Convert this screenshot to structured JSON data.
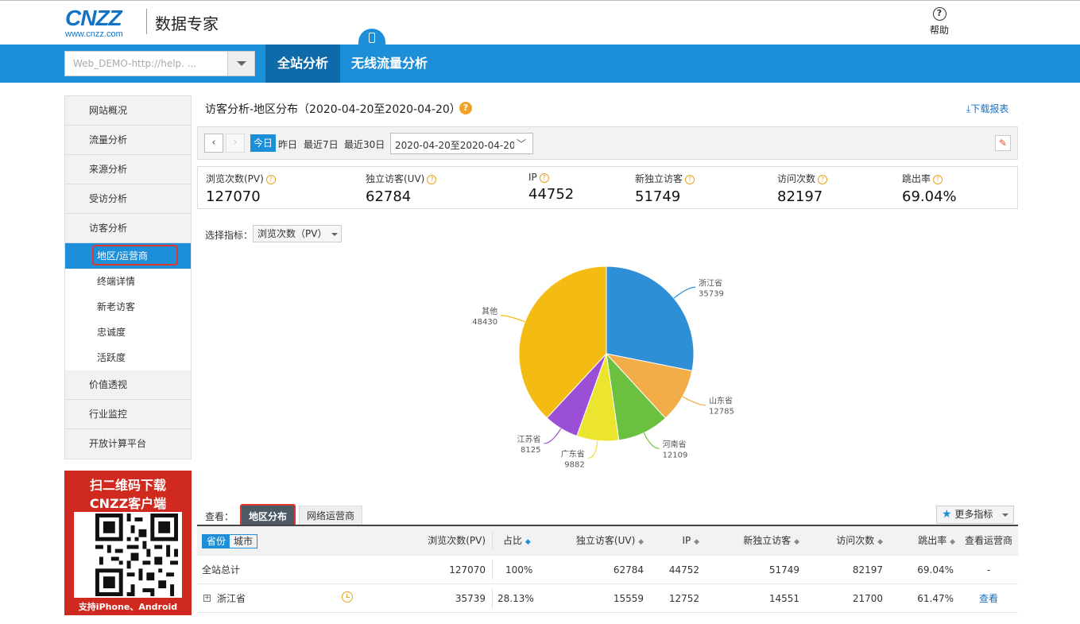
{
  "header": {
    "logo_main": "CNZZ",
    "logo_sub": "www.cnzz.com",
    "brand": "数据专家",
    "help_icon": "question-circle-icon",
    "help_label": "帮助"
  },
  "nav": {
    "site_select_value": "Web_DEMO-http://help. ...",
    "tabs": [
      {
        "label": "全站分析",
        "active": true
      },
      {
        "label": "无线流量分析",
        "active": false
      }
    ],
    "accent": "#1d8fd9"
  },
  "sidebar": {
    "items": [
      {
        "label": "网站概况"
      },
      {
        "label": "流量分析"
      },
      {
        "label": "来源分析"
      },
      {
        "label": "受访分析"
      },
      {
        "label": "访客分析"
      }
    ],
    "subitems": [
      {
        "label": "地区/运营商",
        "active": true
      },
      {
        "label": "终端详情"
      },
      {
        "label": "新老访客"
      },
      {
        "label": "忠诚度"
      },
      {
        "label": "活跃度"
      }
    ],
    "items_after": [
      {
        "label": "价值透视"
      },
      {
        "label": "行业监控"
      },
      {
        "label": "开放计算平台"
      }
    ],
    "promo": {
      "line1": "扫二维码下载",
      "line2": "CNZZ客户端",
      "footer": "支持iPhone、Android"
    }
  },
  "main": {
    "title": "访客分析-地区分布（2020-04-20至2020-04-20）",
    "download_label": "下载报表",
    "date_bar": {
      "today": "今日",
      "yesterday": "昨日",
      "last7": "最近7日",
      "last30": "最近30日",
      "range_value": "2020-04-20至2020-04-20"
    },
    "metrics": [
      {
        "label": "浏览次数(PV)",
        "value": "127070"
      },
      {
        "label": "独立访客(UV)",
        "value": "62784"
      },
      {
        "label": "IP",
        "value": "44752"
      },
      {
        "label": "新独立访客",
        "value": "51749"
      },
      {
        "label": "访问次数",
        "value": "82197"
      },
      {
        "label": "跳出率",
        "value": "69.04%"
      }
    ],
    "indicator_label": "选择指标：",
    "indicator_value": "浏览次数（PV）",
    "view_label": "查看：",
    "view_tabs": [
      {
        "label": "地区分布",
        "active": true
      },
      {
        "label": "网络运营商",
        "active": false
      }
    ],
    "more_metrics": "更多指标"
  },
  "chart_data": {
    "type": "pie",
    "slices": [
      {
        "label": "浙江省",
        "value": 35739,
        "color": "#2f8fd6"
      },
      {
        "label": "山东省",
        "value": 12785,
        "color": "#f2ac48"
      },
      {
        "label": "河南省",
        "value": 12109,
        "color": "#6cc040"
      },
      {
        "label": "广东省",
        "value": 9882,
        "color": "#ece530"
      },
      {
        "label": "江苏省",
        "value": 8125,
        "color": "#9b4fd6"
      },
      {
        "label": "其他",
        "value": 48430,
        "color": "#f4bb12"
      }
    ]
  },
  "table": {
    "toggle": [
      "省份",
      "城市"
    ],
    "columns": [
      "浏览次数(PV)",
      "占比",
      "独立访客(UV)",
      "IP",
      "新独立访客",
      "访问次数",
      "跳出率",
      "查看运营商"
    ],
    "rows": [
      {
        "name": "全站总计",
        "pv": "127070",
        "pct": "100%",
        "uv": "62784",
        "ip": "44752",
        "new_uv": "51749",
        "visits": "82197",
        "bounce": "69.04%",
        "view": "-"
      },
      {
        "name": "浙江省",
        "pv": "35739",
        "pct": "28.13%",
        "uv": "15559",
        "ip": "12752",
        "new_uv": "14551",
        "visits": "21700",
        "bounce": "61.47%",
        "view": "查看"
      }
    ]
  }
}
